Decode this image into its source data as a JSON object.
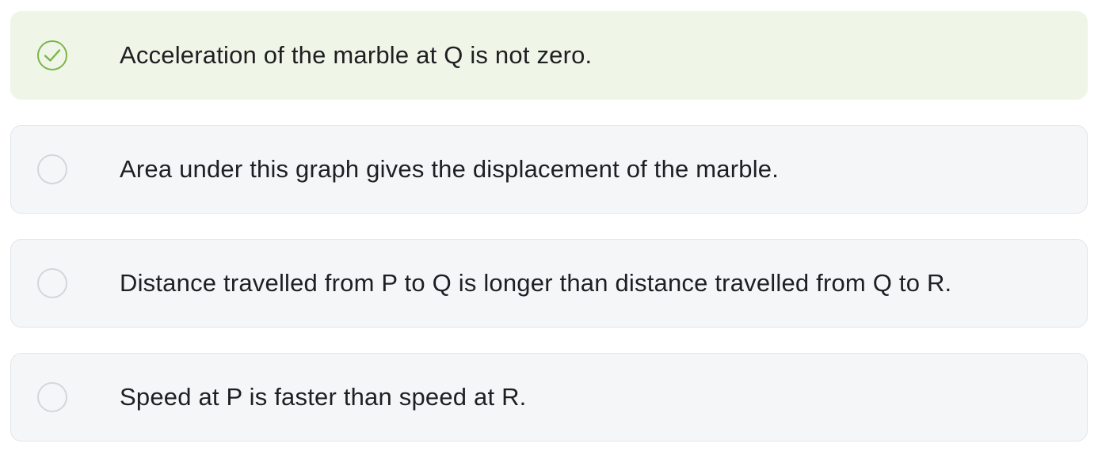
{
  "question": {
    "options": [
      {
        "label": "Acceleration of the marble at Q is not zero.",
        "selected": true,
        "icon": "check-icon",
        "accent": "#7bb548"
      },
      {
        "label": "Area under this graph gives the displacement of the marble.",
        "selected": false
      },
      {
        "label": "Distance travelled from P to Q is longer than distance travelled from Q to R.",
        "selected": false
      },
      {
        "label": "Speed at P is faster than speed at R.",
        "selected": false
      }
    ]
  }
}
